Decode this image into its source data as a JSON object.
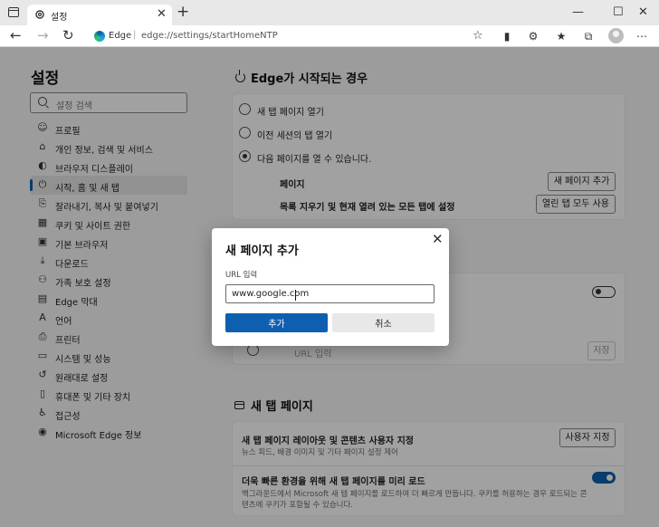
{
  "browser": {
    "tab_title": "설정",
    "address_app": "Edge",
    "address_url": "edge://settings/startHomeNTP"
  },
  "sidebar": {
    "title": "설정",
    "search_placeholder": "설정 검색",
    "items": [
      {
        "label": "프로필",
        "icon": "profile-icon"
      },
      {
        "label": "개인 정보, 검색 및 서비스",
        "icon": "lock-icon"
      },
      {
        "label": "브라우저 디스플레이",
        "icon": "appearance-icon"
      },
      {
        "label": "시작, 홈 및 새 탭",
        "icon": "power-icon",
        "active": true
      },
      {
        "label": "잘라내기, 복사 및 붙여넣기",
        "icon": "share-icon"
      },
      {
        "label": "쿠키 및 사이트 권한",
        "icon": "cookie-icon"
      },
      {
        "label": "기본 브라우저",
        "icon": "browser-icon"
      },
      {
        "label": "다운로드",
        "icon": "download-icon"
      },
      {
        "label": "가족 보호 설정",
        "icon": "family-icon"
      },
      {
        "label": "Edge 막대",
        "icon": "edge-bar-icon"
      },
      {
        "label": "언어",
        "icon": "language-icon"
      },
      {
        "label": "프린터",
        "icon": "printer-icon"
      },
      {
        "label": "시스템 및 성능",
        "icon": "system-icon"
      },
      {
        "label": "원래대로 설정",
        "icon": "reset-icon"
      },
      {
        "label": "휴대폰 및 기타 장치",
        "icon": "phone-icon"
      },
      {
        "label": "접근성",
        "icon": "accessibility-icon"
      },
      {
        "label": "Microsoft Edge 정보",
        "icon": "edge-logo-icon"
      }
    ]
  },
  "startup": {
    "title": "Edge가 시작되는 경우",
    "options": [
      "새 탭 페이지 열기",
      "이전 세션의 탭 열기",
      "다음 페이지를 열 수 있습니다."
    ],
    "pages_label": "페이지",
    "add_page_button": "새 페이지 추가",
    "clear_label": "목록 지우기 및 현재 열려 있는 모든 탭에 설정",
    "use_open_tabs_button": "열린 탭 모두 사용",
    "url_placeholder": "URL 입력",
    "save_button": "저장"
  },
  "new_tab": {
    "title": "새 탭 페이지",
    "customize_title": "새 탭 페이지 레이아웃 및 콘텐츠 사용자 지정",
    "customize_sub": "뉴스 피드, 배경 이미지 및 기타 페이지 설정 제어",
    "customize_button": "사용자 지정",
    "preload_title": "더욱 빠른 환경을 위해 새 탭 페이지를 미리 로드",
    "preload_sub_line1": "백그라운드에서 Microsoft 새 탭 페이지를 로드하여 더 빠르게 만듭니다. 쿠키를 허용하는 경우 로드되는 콘",
    "preload_sub_line2": "텐츠에 쿠키가 포함될 수 있습니다."
  },
  "dialog": {
    "title": "새 페이지 추가",
    "url_label": "URL 입력",
    "url_value": "www.google.com",
    "add_button": "추가",
    "cancel_button": "취소"
  },
  "colors": {
    "accent": "#0f5fb0",
    "overlay": "rgba(0,0,0,0.37)"
  }
}
